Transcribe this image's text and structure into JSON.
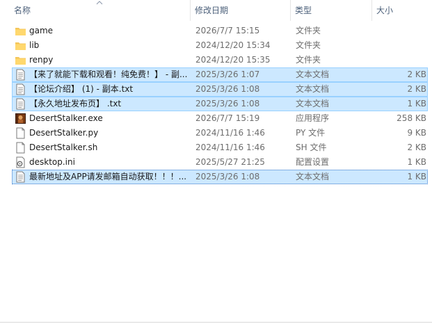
{
  "columns": {
    "name": "名称",
    "date": "修改日期",
    "type": "类型",
    "size": "大小"
  },
  "files": [
    {
      "name": "game",
      "date": "2026/7/7 15:15",
      "type": "文件夹",
      "size": "",
      "icon": "folder-icon"
    },
    {
      "name": "lib",
      "date": "2024/12/20 15:34",
      "type": "文件夹",
      "size": "",
      "icon": "folder-icon"
    },
    {
      "name": "renpy",
      "date": "2024/12/20 15:35",
      "type": "文件夹",
      "size": "",
      "icon": "folder-icon"
    },
    {
      "name": "【来了就能下载和观看！纯免费！】 - 副...",
      "date": "2025/3/26 1:07",
      "type": "文本文档",
      "size": "2 KB",
      "icon": "text-document-icon"
    },
    {
      "name": "【论坛介绍】 (1) - 副本.txt",
      "date": "2025/3/26 1:08",
      "type": "文本文档",
      "size": "2 KB",
      "icon": "text-document-icon"
    },
    {
      "name": "【永久地址发布页】 .txt",
      "date": "2025/3/26 1:08",
      "type": "文本文档",
      "size": "1 KB",
      "icon": "text-document-icon"
    },
    {
      "name": "DesertStalker.exe",
      "date": "2026/7/7 15:19",
      "type": "应用程序",
      "size": "258 KB",
      "icon": "game-exe-icon"
    },
    {
      "name": "DesertStalker.py",
      "date": "2024/11/16 1:46",
      "type": "PY 文件",
      "size": "9 KB",
      "icon": "file-icon"
    },
    {
      "name": "DesertStalker.sh",
      "date": "2024/11/16 1:46",
      "type": "SH 文件",
      "size": "2 KB",
      "icon": "file-icon"
    },
    {
      "name": "desktop.ini",
      "date": "2025/5/27 21:25",
      "type": "配置设置",
      "size": "1 KB",
      "icon": "settings-file-icon"
    },
    {
      "name": "最新地址及APP请发邮箱自动获取！！！...",
      "date": "2025/3/26 1:08",
      "type": "文本文档",
      "size": "1 KB",
      "icon": "text-document-icon"
    }
  ]
}
